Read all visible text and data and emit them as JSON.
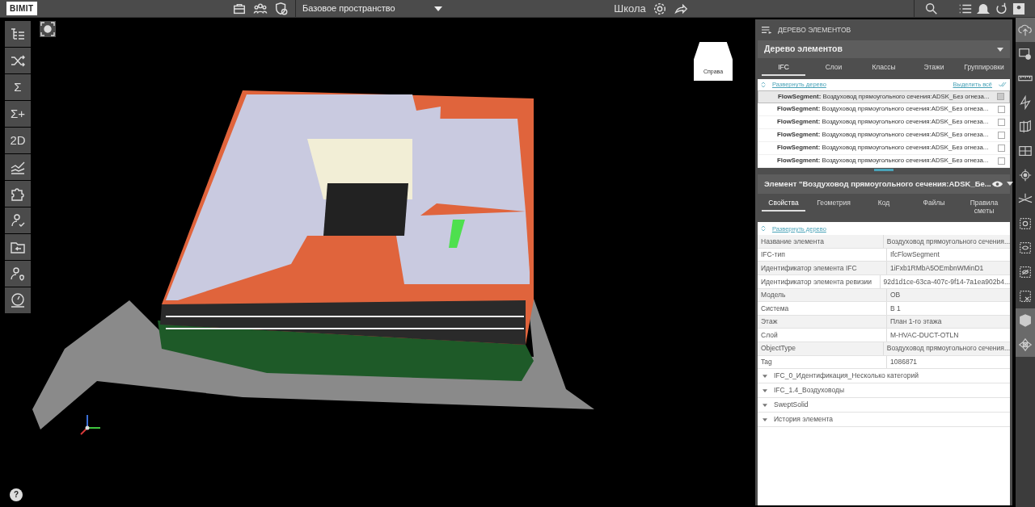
{
  "top_bar": {
    "logo": "BIMIT",
    "space": "Базовое пространство",
    "project": "Школа"
  },
  "left_toolbar": [
    {
      "kind": "tree"
    },
    {
      "kind": "shuffle"
    },
    {
      "kind": "glyph",
      "glyph": "Σ"
    },
    {
      "kind": "glyph",
      "glyph": "Σ+"
    },
    {
      "kind": "glyph",
      "glyph": "2D"
    },
    {
      "kind": "chart"
    },
    {
      "kind": "puzzle"
    },
    {
      "kind": "user-check"
    },
    {
      "kind": "folder"
    },
    {
      "kind": "user-pin"
    },
    {
      "kind": "gauge"
    }
  ],
  "view_cube": {
    "label": "Справа"
  },
  "help": {
    "label": "?"
  },
  "tree_panel": {
    "title": "ДЕРЕВО ЭЛЕМЕНТОВ",
    "dropdown": "Дерево элементов",
    "tabs": [
      {
        "label": "IFC",
        "selected": true
      },
      {
        "label": "Слои",
        "selected": false
      },
      {
        "label": "Классы",
        "selected": false
      },
      {
        "label": "Этажи",
        "selected": false
      },
      {
        "label": "Группировки",
        "selected": false
      }
    ],
    "expand": "Развернуть дерево",
    "select_all": "Выделить всё",
    "items": [
      {
        "text": "**FlowSegment:** Воздуховод прямоугольного сечения:ADSK_Без огнеза...",
        "selected": true,
        "checked": true
      },
      {
        "text": "**FlowSegment:** Воздуховод прямоугольного сечения:ADSK_Без огнеза...",
        "selected": false,
        "checked": false
      },
      {
        "text": "**FlowSegment:** Воздуховод прямоугольного сечения:ADSK_Без огнеза...",
        "selected": false,
        "checked": false
      },
      {
        "text": "**FlowSegment:** Воздуховод прямоугольного сечения:ADSK_Без огнеза...",
        "selected": false,
        "checked": false
      },
      {
        "text": "**FlowSegment:** Воздуховод прямоугольного сечения:ADSK_Без огнеза...",
        "selected": false,
        "checked": false
      },
      {
        "text": "**FlowSegment:** Воздуховод прямоугольного сечения:ADSK_Без огнеза...",
        "selected": false,
        "checked": false
      }
    ]
  },
  "element_panel": {
    "title": "Элемент \"Воздуховод прямоугольного сечения:ADSK_Бе...",
    "tabs": [
      {
        "label": "Свойства",
        "selected": true
      },
      {
        "label": "Геометрия",
        "selected": false
      },
      {
        "label": "Код",
        "selected": false
      },
      {
        "label": "Файлы",
        "selected": false
      },
      {
        "label": "Правила сметы",
        "selected": false
      }
    ],
    "expand": "Развернуть дерево",
    "properties": [
      {
        "name": "Название элемента",
        "value": "Воздуховод прямоугольного сечения..."
      },
      {
        "name": "IFC-тип",
        "value": "IfcFlowSegment"
      },
      {
        "name": "Идентификатор элемента IFC",
        "value": "1iFxb1RMbA5OEmbnWMinD1"
      },
      {
        "name": "Идентификатор элемента ревизии",
        "value": "92d1d1ce-63ca-407c-9f14-7a1ea902b4..."
      },
      {
        "name": "Модель",
        "value": "ОВ"
      },
      {
        "name": "Система",
        "value": "В 1"
      },
      {
        "name": "Этаж",
        "value": "План 1-го этажа"
      },
      {
        "name": "Слой",
        "value": "M-HVAC-DUCT-OTLN"
      },
      {
        "name": "ObjectType",
        "value": "Воздуховод прямоугольного сечения..."
      },
      {
        "name": "Tag",
        "value": "1086871"
      }
    ],
    "sections": [
      {
        "label": "IFC_0_Идентификация_Несколько категорий",
        "expanded": false
      },
      {
        "label": "IFC_1.4_Воздуховоды",
        "expanded": false
      },
      {
        "label": "SweptSolid",
        "expanded": false
      },
      {
        "label": "История элемента",
        "expanded": false
      }
    ]
  },
  "right_toolbar": [
    {
      "kind": "cloud",
      "selected": true
    },
    {
      "kind": "screen",
      "selected": false
    },
    {
      "kind": "ruler",
      "selected": false
    },
    {
      "kind": "plane",
      "selected": false
    },
    {
      "kind": "section",
      "selected": false
    },
    {
      "kind": "grid",
      "selected": false
    },
    {
      "kind": "target",
      "selected": false
    },
    {
      "kind": "cross",
      "selected": false
    },
    {
      "kind": "box-dot",
      "selected": false
    },
    {
      "kind": "box-eye",
      "selected": false
    },
    {
      "kind": "box-hide",
      "selected": false
    },
    {
      "kind": "box-x",
      "selected": false
    },
    {
      "kind": "cube",
      "selected": true
    },
    {
      "kind": "orbit",
      "selected": true
    }
  ]
}
